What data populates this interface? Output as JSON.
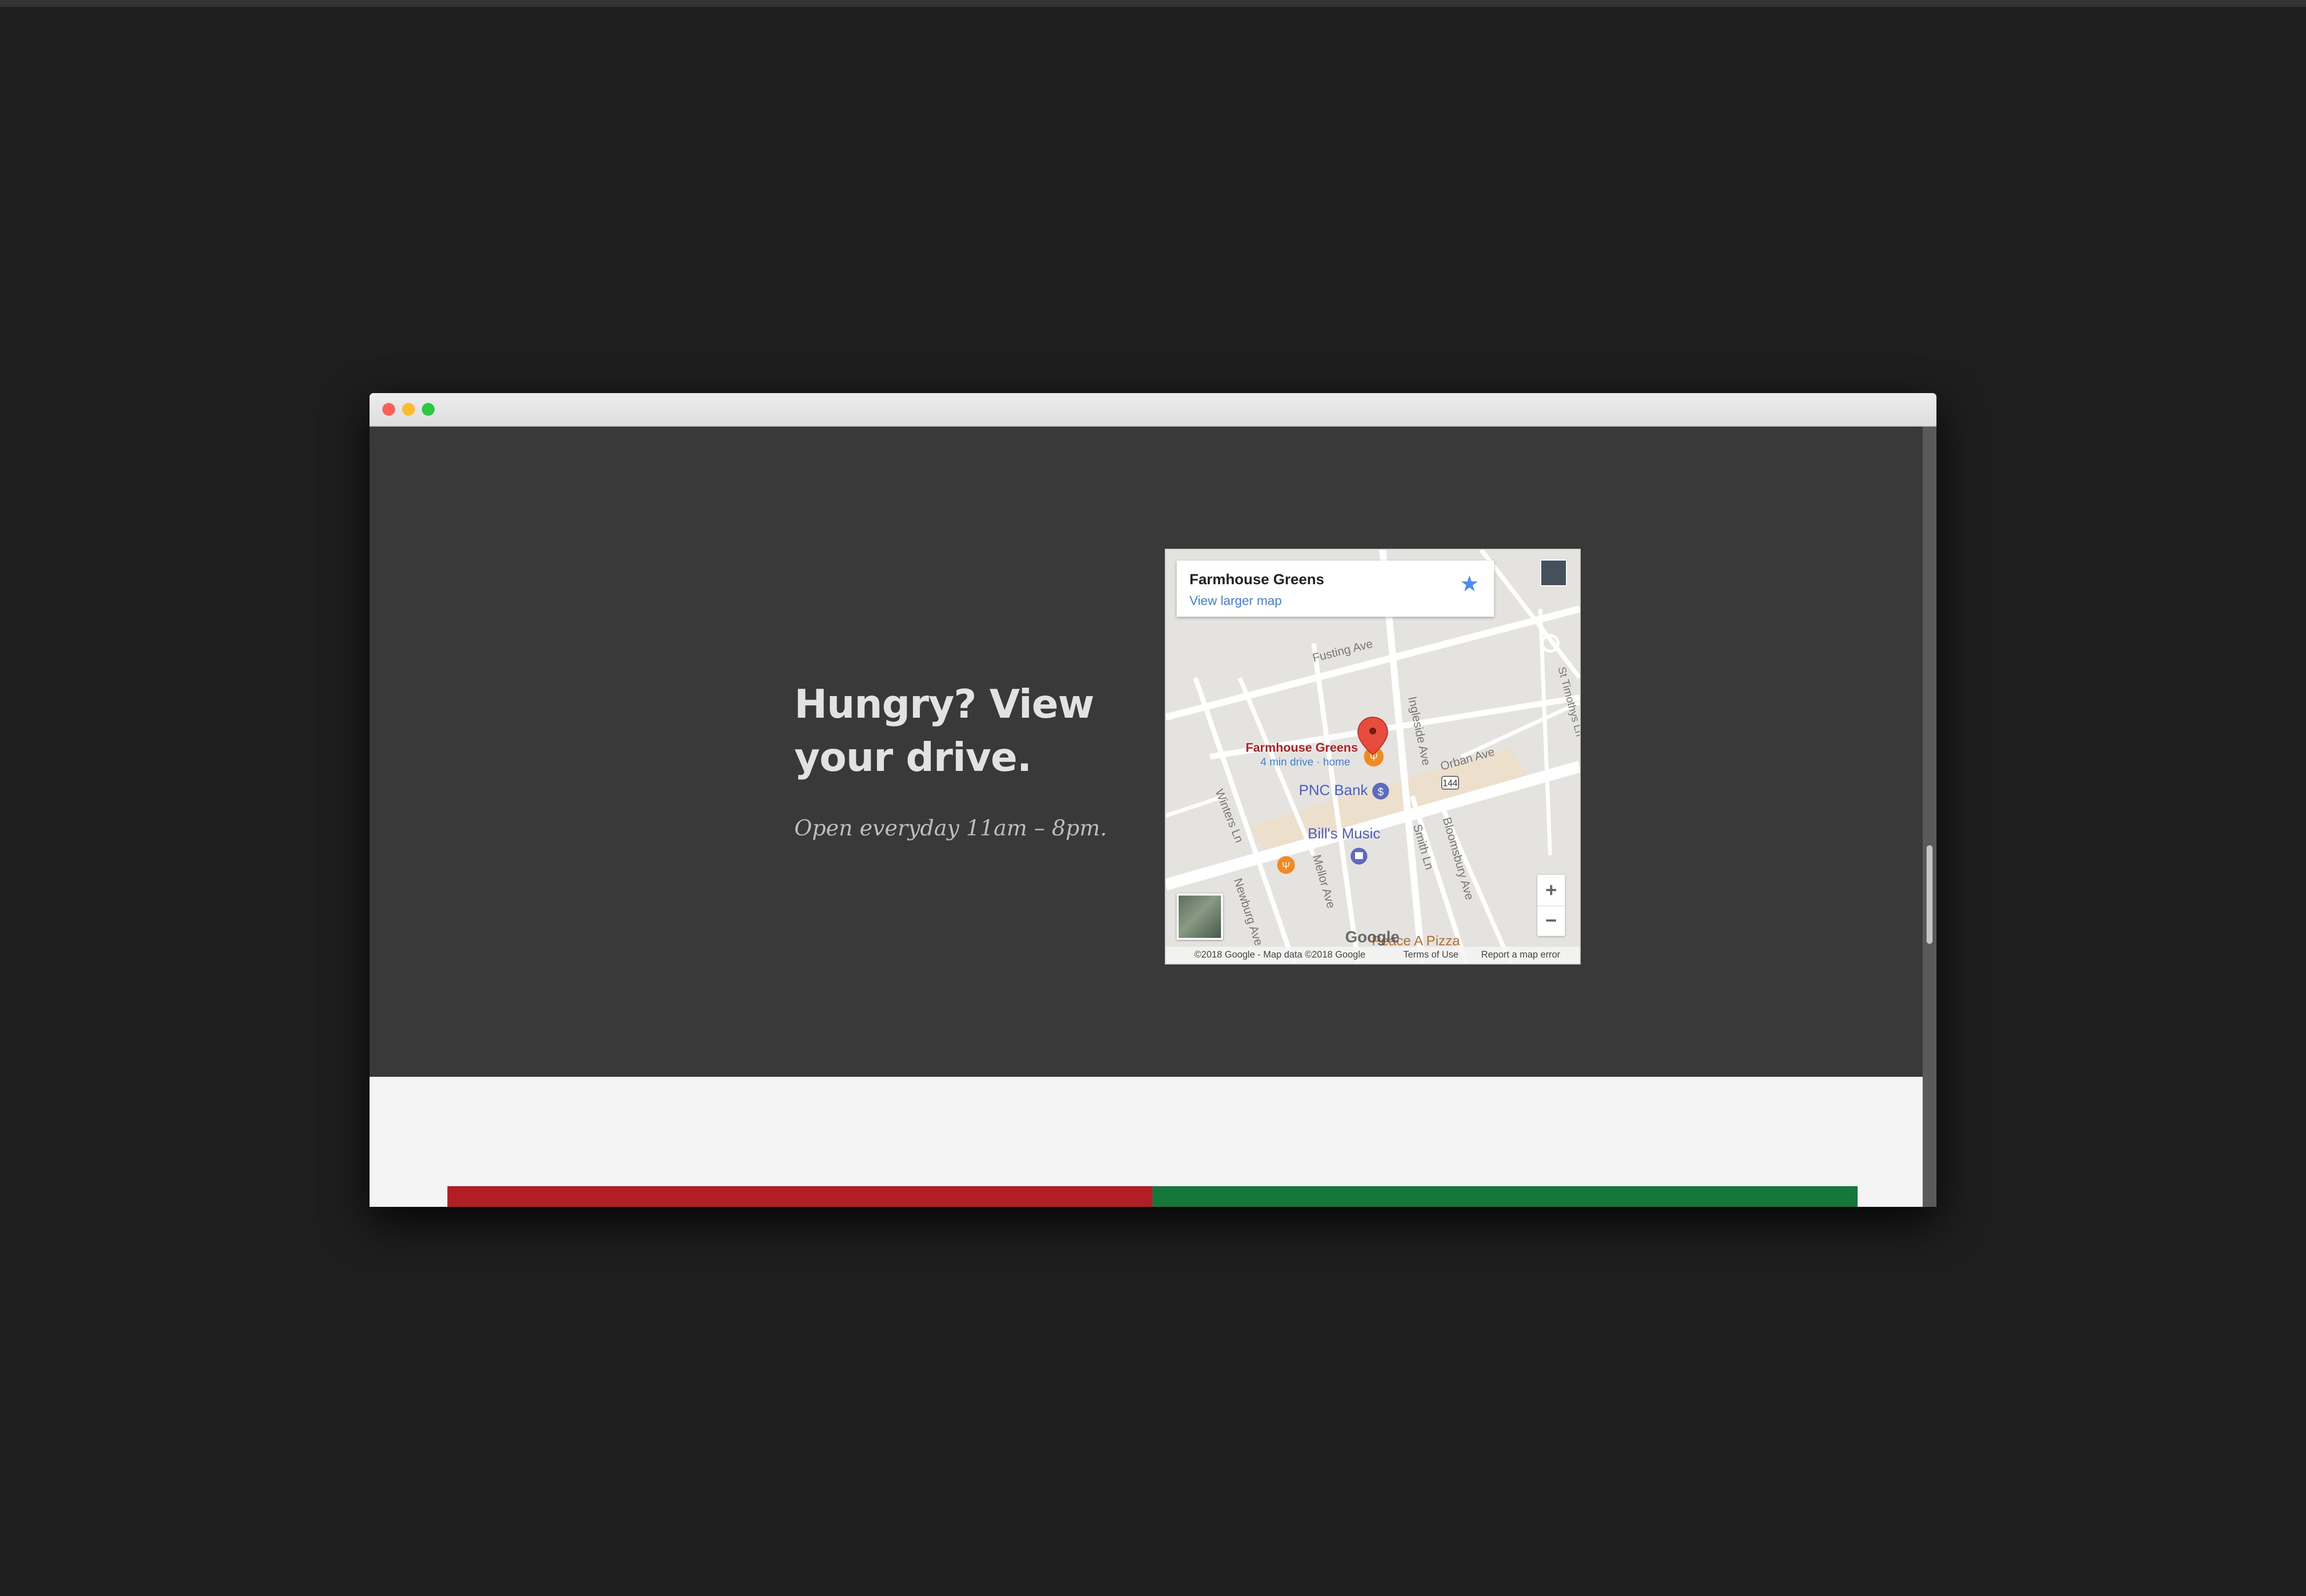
{
  "window": {
    "controls": [
      "close",
      "minimize",
      "zoom"
    ]
  },
  "hero": {
    "headline": "Hungry? View your drive.",
    "hours": "Open everyday 11am – 8pm."
  },
  "map": {
    "place_name": "Farmhouse Greens",
    "view_larger": "View larger map",
    "star_icon": "star-icon",
    "marker_label": "Farmhouse Greens",
    "marker_sublabel": "4 min drive · home",
    "poi_bank": "PNC Bank",
    "poi_music": "Bill's Music",
    "poi_pizza": "Peace A Pizza",
    "streets": [
      "Fusting Ave",
      "Ingleside Ave",
      "Orban Ave",
      "St Timothys Ln",
      "Winters Ln",
      "Newburg Ave",
      "Mellor Ave",
      "Smith Ln",
      "Bloomsbury Ave"
    ],
    "route_shield": "144",
    "zoom_in": "+",
    "zoom_out": "−",
    "logo": "Google",
    "copyright": "©2018 Google - Map data ©2018 Google",
    "terms": "Terms of Use",
    "report": "Report a map error"
  },
  "colors": {
    "hero_bg": "#393939",
    "page_bg": "#f4f4f4",
    "bar_red": "#b11f24",
    "bar_green": "#16773b",
    "marker": "#e74c3c"
  }
}
